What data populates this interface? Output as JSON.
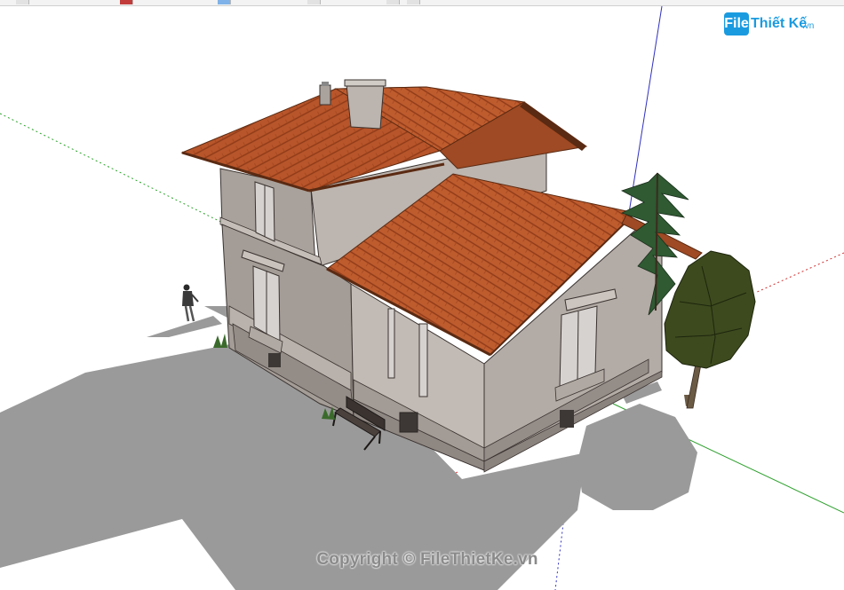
{
  "watermark": {
    "logo_box": "File",
    "logo_text": "Thiết Kế",
    "logo_tld": ".vn",
    "copyright": "Copyright © FileThietKe.vn"
  },
  "colors": {
    "background": "#ffffff",
    "shadow": "#9a9a9a",
    "wall": "#a39b95",
    "roof": "#b8552a",
    "axis_red": "#d03030",
    "axis_green": "#2ea02e",
    "axis_blue": "#3030c0",
    "brand_blue": "#1a9be0"
  },
  "icons": [
    "person-figure-icon",
    "pine-tree-icon",
    "deciduous-tree-icon",
    "bench-icon",
    "chimney-icon"
  ]
}
